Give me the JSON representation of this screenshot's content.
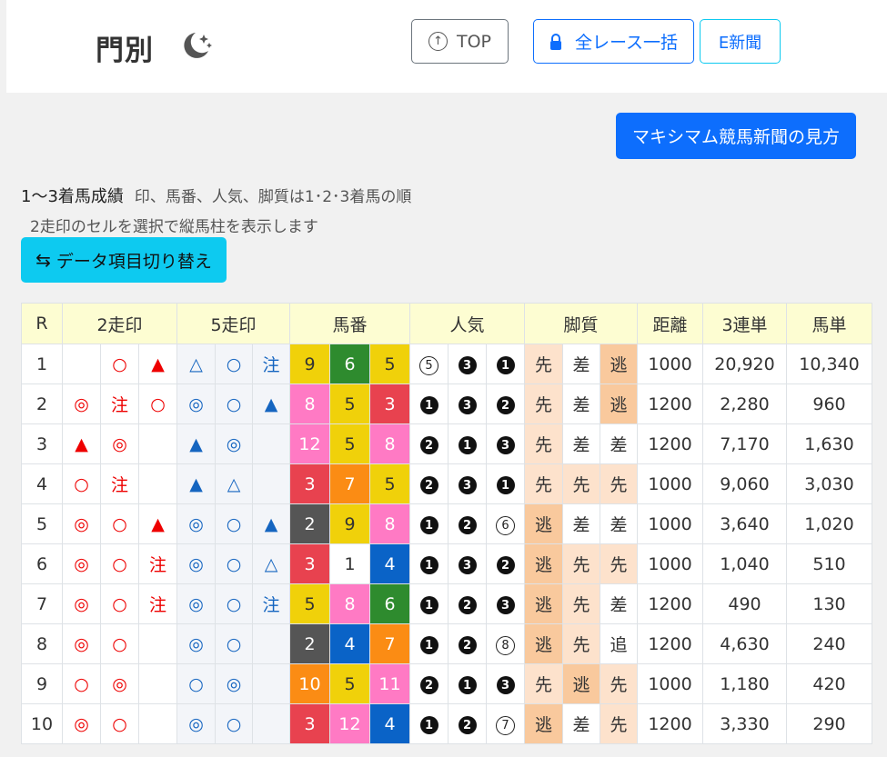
{
  "header": {
    "title": "門別",
    "top_label": "TOP",
    "all_races_label": "全レース一括",
    "e_news_label": "E新聞"
  },
  "guide_button": "マキシマム競馬新聞の見方",
  "info": {
    "title": "1〜3着馬成績",
    "subtitle": "印、馬番、人気、脚質は1･2･3着馬の順",
    "hint": "2走印のセルを選択で縦馬柱を表示します"
  },
  "switch_button": "データ項目切り替え",
  "colors": {
    "primary": "#0d6efd",
    "info": "#0dcaf0",
    "header_bg": "#fdfdd2",
    "mark2": "#ee0000",
    "mark5": "#1565c0",
    "leg_nige": "#f9c99d",
    "leg_sen": "#fde2cc"
  },
  "table": {
    "headers": [
      "R",
      "2走印",
      "5走印",
      "馬番",
      "人気",
      "脚質",
      "距離",
      "3連単",
      "馬単"
    ],
    "rows": [
      {
        "r": "1",
        "m2": [
          "",
          "○",
          "▲"
        ],
        "m5": [
          "△",
          "○",
          "注"
        ],
        "nums": [
          "9",
          "6",
          "5"
        ],
        "pop": [
          "⑤",
          "❸",
          "❶"
        ],
        "leg": [
          "先",
          "差",
          "逃"
        ],
        "dist": "1000",
        "tri": "20,920",
        "exa": "10,340"
      },
      {
        "r": "2",
        "m2": [
          "◎",
          "注",
          "○"
        ],
        "m5": [
          "◎",
          "○",
          "▲"
        ],
        "nums": [
          "8",
          "5",
          "3"
        ],
        "pop": [
          "❶",
          "❸",
          "❷"
        ],
        "leg": [
          "先",
          "差",
          "逃"
        ],
        "dist": "1200",
        "tri": "2,280",
        "exa": "960"
      },
      {
        "r": "3",
        "m2": [
          "▲",
          "◎",
          ""
        ],
        "m5": [
          "▲",
          "◎",
          ""
        ],
        "nums": [
          "12",
          "5",
          "8"
        ],
        "pop": [
          "❷",
          "❶",
          "❸"
        ],
        "leg": [
          "先",
          "差",
          "差"
        ],
        "dist": "1200",
        "tri": "7,170",
        "exa": "1,630"
      },
      {
        "r": "4",
        "m2": [
          "○",
          "注",
          ""
        ],
        "m5": [
          "▲",
          "△",
          ""
        ],
        "nums": [
          "3",
          "7",
          "5"
        ],
        "pop": [
          "❷",
          "❸",
          "❶"
        ],
        "leg": [
          "先",
          "先",
          "先"
        ],
        "dist": "1000",
        "tri": "9,060",
        "exa": "3,030"
      },
      {
        "r": "5",
        "m2": [
          "◎",
          "○",
          "▲"
        ],
        "m5": [
          "◎",
          "○",
          "▲"
        ],
        "nums": [
          "2",
          "9",
          "8"
        ],
        "pop": [
          "❶",
          "❷",
          "⑥"
        ],
        "leg": [
          "逃",
          "差",
          "差"
        ],
        "dist": "1000",
        "tri": "3,640",
        "exa": "1,020"
      },
      {
        "r": "6",
        "m2": [
          "◎",
          "○",
          "注"
        ],
        "m5": [
          "◎",
          "○",
          "△"
        ],
        "nums": [
          "3",
          "1",
          "4"
        ],
        "pop": [
          "❶",
          "❸",
          "❷"
        ],
        "leg": [
          "逃",
          "先",
          "先"
        ],
        "dist": "1000",
        "tri": "1,040",
        "exa": "510"
      },
      {
        "r": "7",
        "m2": [
          "◎",
          "○",
          "注"
        ],
        "m5": [
          "◎",
          "○",
          "注"
        ],
        "nums": [
          "5",
          "8",
          "6"
        ],
        "pop": [
          "❶",
          "❷",
          "❸"
        ],
        "leg": [
          "逃",
          "先",
          "差"
        ],
        "dist": "1200",
        "tri": "490",
        "exa": "130"
      },
      {
        "r": "8",
        "m2": [
          "◎",
          "○",
          ""
        ],
        "m5": [
          "◎",
          "○",
          ""
        ],
        "nums": [
          "2",
          "4",
          "7"
        ],
        "pop": [
          "❶",
          "❷",
          "⑧"
        ],
        "leg": [
          "逃",
          "先",
          "追"
        ],
        "dist": "1200",
        "tri": "4,630",
        "exa": "240"
      },
      {
        "r": "9",
        "m2": [
          "○",
          "◎",
          ""
        ],
        "m5": [
          "○",
          "◎",
          ""
        ],
        "nums": [
          "10",
          "5",
          "11"
        ],
        "pop": [
          "❷",
          "❶",
          "❸"
        ],
        "leg": [
          "先",
          "逃",
          "先"
        ],
        "dist": "1000",
        "tri": "1,180",
        "exa": "420"
      },
      {
        "r": "10",
        "m2": [
          "◎",
          "○",
          ""
        ],
        "m5": [
          "◎",
          "○",
          ""
        ],
        "nums": [
          "3",
          "12",
          "4"
        ],
        "pop": [
          "❶",
          "❷",
          "⑦"
        ],
        "leg": [
          "逃",
          "差",
          "先"
        ],
        "dist": "1200",
        "tri": "3,330",
        "exa": "290"
      }
    ]
  }
}
